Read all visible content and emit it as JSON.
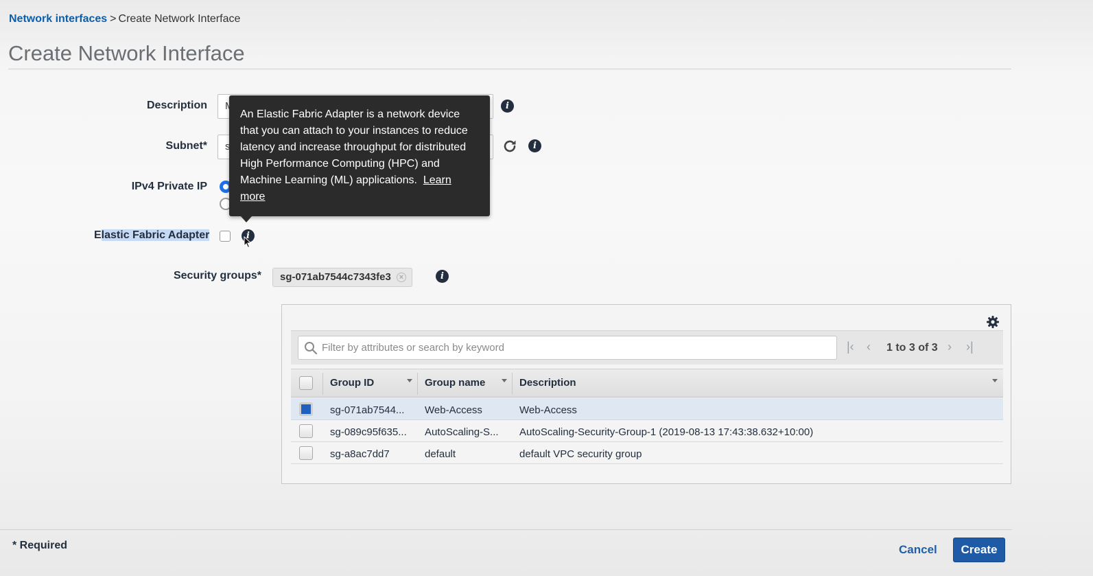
{
  "breadcrumb": {
    "parent_link": "Network interfaces",
    "separator": ">",
    "current": "Create Network Interface"
  },
  "page_title": "Create Network Interface",
  "form": {
    "description": {
      "label": "Description",
      "value": "M"
    },
    "subnet": {
      "label": "Subnet*",
      "value": "s"
    },
    "ipv4": {
      "label": "IPv4 Private IP",
      "selected_option_index": 0
    },
    "efa": {
      "label_first_char": "E",
      "label_rest": "lastic Fabric Adapter",
      "checked": false
    },
    "security_groups": {
      "label": "Security groups*",
      "token": "sg-071ab7544c7343fe3",
      "token_remove": "×"
    }
  },
  "tooltip": {
    "line1": "An Elastic Fabric Adapter is a network device",
    "line2": "that you can attach to your instances to reduce",
    "line3": "latency and increase throughput for distributed",
    "line4": "High Performance Computing (HPC) and",
    "line5": "Machine Learning (ML) applications.",
    "learn_more_1": "Learn",
    "learn_more_2": "more"
  },
  "table": {
    "search_placeholder": "Filter by attributes or search by keyword",
    "pagination": "1 to 3 of 3",
    "columns": [
      "Group ID",
      "Group name",
      "Description"
    ],
    "rows": [
      {
        "id": "sg-071ab7544...",
        "name": "Web-Access",
        "description": "Web-Access",
        "selected": true
      },
      {
        "id": "sg-089c95f635...",
        "name": "AutoScaling-S...",
        "description": "AutoScaling-Security-Group-1 (2019-08-13 17:43:38.632+10:00)",
        "selected": false
      },
      {
        "id": "sg-a8ac7dd7",
        "name": "default",
        "description": "default VPC security group",
        "selected": false
      }
    ]
  },
  "footer": {
    "required_note": "* Required",
    "cancel_label": "Cancel",
    "create_label": "Create"
  },
  "icons": {
    "info": "info-icon",
    "refresh": "refresh-icon",
    "settings": "gear-icon",
    "search": "search-icon",
    "pager": [
      "first-page-icon",
      "prev-page-icon",
      "next-page-icon",
      "last-page-icon"
    ]
  },
  "colors": {
    "link": "#0d5ea8",
    "primary_button": "#1f5aa6",
    "tooltip_bg": "#2b2b2b",
    "selected_row": "#dfe7f2",
    "label_highlight": "#c6d9f5"
  }
}
